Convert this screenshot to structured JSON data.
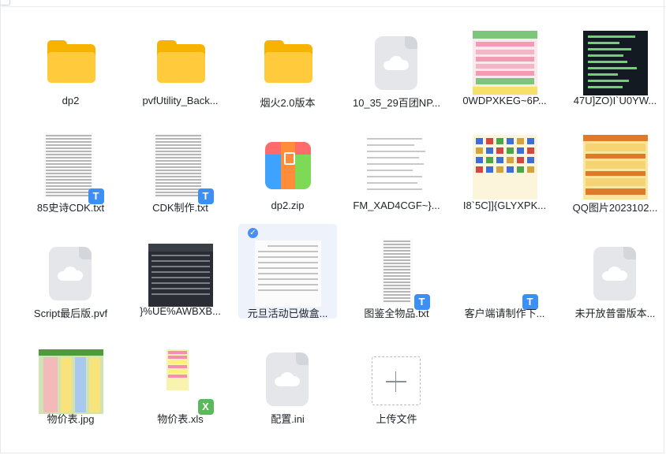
{
  "files": [
    {
      "name": "dp2",
      "type": "folder"
    },
    {
      "name": "pvfUtility_Back...",
      "type": "folder"
    },
    {
      "name": "烟火2.0版本",
      "type": "folder"
    },
    {
      "name": "10_35_29百团NP...",
      "type": "cloud"
    },
    {
      "name": "0WDPXKEG~6P...",
      "type": "image"
    },
    {
      "name": "47U]ZO)I`U0YW...",
      "type": "image"
    },
    {
      "name": "85史诗CDK.txt",
      "type": "txt"
    },
    {
      "name": "CDK制作.txt",
      "type": "txt"
    },
    {
      "name": "dp2.zip",
      "type": "zip"
    },
    {
      "name": "FM_XAD4CGF~}...",
      "type": "image"
    },
    {
      "name": "I8`5C]]{GLYXPK...",
      "type": "image"
    },
    {
      "name": "QQ图片2023102...",
      "type": "image"
    },
    {
      "name": "Script最后版.pvf",
      "type": "cloud"
    },
    {
      "name": "}%UE%AWBXB...",
      "type": "image"
    },
    {
      "name": "元旦活动已做盒...",
      "type": "image",
      "selected": true
    },
    {
      "name": "图鉴全物品.txt",
      "type": "txt"
    },
    {
      "name": "客户端请制作下...",
      "type": "txt"
    },
    {
      "name": "未开放普雷版本...",
      "type": "cloud"
    },
    {
      "name": "物价表.jpg",
      "type": "image"
    },
    {
      "name": "物价表.xls",
      "type": "xls"
    },
    {
      "name": "配置.ini",
      "type": "cloud"
    },
    {
      "name": "上传文件",
      "type": "upload"
    }
  ],
  "badges": {
    "txt": "T",
    "xls": "X"
  },
  "colors": {
    "folder": "#ffcb3d",
    "selection": "#eef3fb",
    "txt_badge": "#3b8ff5",
    "xls_badge": "#5cb85c"
  }
}
